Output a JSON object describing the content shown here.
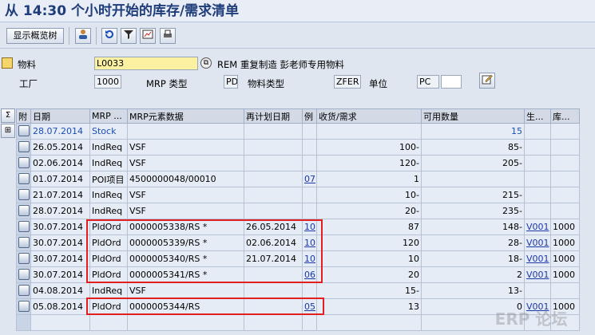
{
  "window": {
    "title": "从 14:30 个小时开始的库存/需求清单"
  },
  "toolbar": {
    "show_overview_tree": "显示概览树"
  },
  "header": {
    "material_label": "物料",
    "material_value": "L0033",
    "material_desc": "REM 重复制造 彭老师专用物料",
    "plant_label": "工厂",
    "plant_value": "1000",
    "mrp_type_label": "MRP 类型",
    "mrp_type_value": "PD",
    "material_type_label": "物料类型",
    "material_type_value": "ZFER",
    "unit_label": "单位",
    "unit_value": "PC"
  },
  "grid": {
    "columns": [
      "附",
      "日期",
      "MRP ...",
      "MRP元素数据",
      "再计划日期",
      "例",
      "收货/需求",
      "可用数量",
      "生...",
      "库..."
    ],
    "rows": [
      {
        "date": "28.07.2014",
        "mrp": "Stock",
        "data": "",
        "resched": "",
        "ex": "",
        "qty": "",
        "avail": "15",
        "prod": "",
        "stor": "",
        "blue": true
      },
      {
        "date": "26.05.2014",
        "mrp": "IndReq",
        "data": "VSF",
        "resched": "",
        "ex": "",
        "qty": "100-",
        "avail": "85-",
        "prod": "",
        "stor": ""
      },
      {
        "date": "02.06.2014",
        "mrp": "IndReq",
        "data": "VSF",
        "resched": "",
        "ex": "",
        "qty": "120-",
        "avail": "205-",
        "prod": "",
        "stor": ""
      },
      {
        "date": "01.07.2014",
        "mrp": "POI项目",
        "data": "4500000048/00010",
        "resched": "",
        "ex": "07",
        "qty": "1",
        "avail": "",
        "prod": "",
        "stor": ""
      },
      {
        "date": "21.07.2014",
        "mrp": "IndReq",
        "data": "VSF",
        "resched": "",
        "ex": "",
        "qty": "10-",
        "avail": "215-",
        "prod": "",
        "stor": ""
      },
      {
        "date": "28.07.2014",
        "mrp": "IndReq",
        "data": "VSF",
        "resched": "",
        "ex": "",
        "qty": "20-",
        "avail": "235-",
        "prod": "",
        "stor": ""
      },
      {
        "date": "30.07.2014",
        "mrp": "PldOrd",
        "data": "0000005338/RS   *",
        "resched": "26.05.2014",
        "ex": "10",
        "qty": "87",
        "avail": "148-",
        "prod": "V001",
        "stor": "1000"
      },
      {
        "date": "30.07.2014",
        "mrp": "PldOrd",
        "data": "0000005339/RS   *",
        "resched": "02.06.2014",
        "ex": "10",
        "qty": "120",
        "avail": "28-",
        "prod": "V001",
        "stor": "1000"
      },
      {
        "date": "30.07.2014",
        "mrp": "PldOrd",
        "data": "0000005340/RS   *",
        "resched": "21.07.2014",
        "ex": "10",
        "qty": "10",
        "avail": "18-",
        "prod": "V001",
        "stor": "1000"
      },
      {
        "date": "30.07.2014",
        "mrp": "PldOrd",
        "data": "0000005341/RS   *",
        "resched": "",
        "ex": "06",
        "qty": "20",
        "avail": "2",
        "prod": "V001",
        "stor": "1000"
      },
      {
        "date": "04.08.2014",
        "mrp": "IndReq",
        "data": "VSF",
        "resched": "",
        "ex": "",
        "qty": "15-",
        "avail": "13-",
        "prod": "",
        "stor": ""
      },
      {
        "date": "05.08.2014",
        "mrp": "PldOrd",
        "data": "0000005344/RS",
        "resched": "",
        "ex": "05",
        "qty": "13",
        "avail": "0",
        "prod": "V001",
        "stor": "1000"
      },
      {
        "date": "",
        "mrp": "",
        "data": "",
        "resched": "",
        "ex": "",
        "qty": "",
        "avail": "",
        "prod": "",
        "stor": ""
      }
    ]
  },
  "watermark": "ERP 论坛"
}
